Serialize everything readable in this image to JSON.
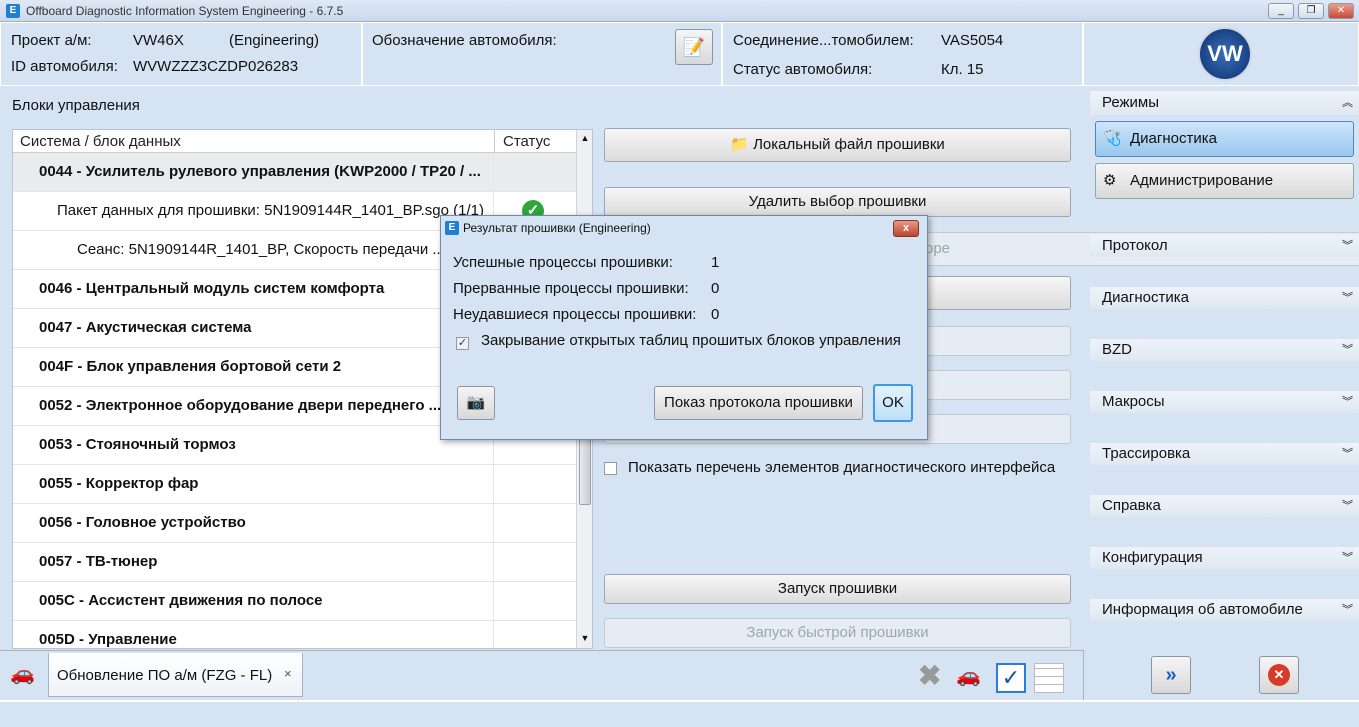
{
  "window": {
    "title": "Offboard Diagnostic Information System Engineering - 6.7.5",
    "min": "_",
    "restore": "❐",
    "close": "✕"
  },
  "header": {
    "project_label": "Проект а/м:",
    "project_value": "VW46X",
    "project_mode": "(Engineering)",
    "vin_label": "ID автомобиля:",
    "vin_value": "WVWZZZ3CZDP026283",
    "designation_label": "Обозначение автомобиля:",
    "connection_label": "Соединение...томобилем:",
    "connection_value": "VAS5054",
    "status_label": "Статус автомобиля:",
    "status_value": "Кл. 15",
    "logo": "VW"
  },
  "ecu": {
    "title": "Блоки управления",
    "col_system": "Система / блок данных",
    "col_status": "Статус",
    "rows": [
      {
        "text": "0044 - Усилитель рулевого управления  (KWP2000 / TP20 / ...",
        "bold": true
      },
      {
        "text": "Пакет данных для прошивки: 5N1909144R_1401_BP.sgo (1/1)",
        "bold": false,
        "indent": 1,
        "status": "ok"
      },
      {
        "text": "Сеанс: 5N1909144R_1401_BP, Скорость передачи ...",
        "bold": false,
        "indent": 2
      },
      {
        "text": "0046 - Центральный модуль систем комфорта",
        "bold": true
      },
      {
        "text": "0047 - Акустическая система",
        "bold": true
      },
      {
        "text": "004F - Блок управления бортовой сети 2",
        "bold": true
      },
      {
        "text": "0052 - Электронное оборудование двери переднего ...",
        "bold": true
      },
      {
        "text": "0053 - Стояночный тормоз",
        "bold": true
      },
      {
        "text": "0055 - Корректор фар",
        "bold": true
      },
      {
        "text": "0056 - Головное устройство",
        "bold": true
      },
      {
        "text": "0057 - ТВ-тюнер",
        "bold": true
      },
      {
        "text": "005C - Ассистент движения по полосе",
        "bold": true
      },
      {
        "text": "005D - Управление",
        "bold": true
      }
    ]
  },
  "actions": {
    "local_file": "Локальный файл прошивки",
    "delete_selection": "Удалить выбор прошивки",
    "partial": "оре",
    "show_interface_list": "Показать перечень элементов диагностического интерфейса",
    "start_flash": "Запуск прошивки",
    "start_fast_flash": "Запуск быстрой прошивки"
  },
  "sidebar": {
    "modes": "Режимы",
    "diagnostics_btn": "Диагностика",
    "admin_btn": "Администрирование",
    "sections": [
      "Протокол",
      "Диагностика",
      "BZD",
      "Макросы",
      "Трассировка",
      "Справка",
      "Конфигурация",
      "Информация об автомобиле"
    ]
  },
  "bottom": {
    "tab_label": "Обновление ПО а/м (FZG - FL)",
    "tab_close": "×"
  },
  "dialog": {
    "title": "Результат прошивки (Engineering)",
    "close": "x",
    "success_label": "Успешные процессы прошивки:",
    "success_value": "1",
    "aborted_label": "Прерванные процессы прошивки:",
    "aborted_value": "0",
    "failed_label": "Неудавшиеся процессы прошивки:",
    "failed_value": "0",
    "close_tables_label": "Закрывание открытых таблиц прошитых блоков управления",
    "close_tables_checked": true,
    "protocol_btn": "Показ протокола прошивки",
    "ok_btn": "OK"
  }
}
